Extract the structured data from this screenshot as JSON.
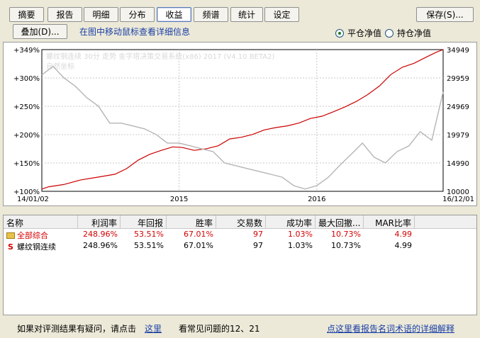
{
  "toolbar": {
    "tabs": [
      {
        "id": "summary",
        "label": "摘要",
        "active": false
      },
      {
        "id": "report",
        "label": "报告",
        "active": false
      },
      {
        "id": "detail",
        "label": "明细",
        "active": false
      },
      {
        "id": "distribution",
        "label": "分布",
        "active": false
      },
      {
        "id": "profit",
        "label": "收益",
        "active": true
      },
      {
        "id": "spectrum",
        "label": "频谱",
        "active": false
      },
      {
        "id": "statistics",
        "label": "统计",
        "active": false
      },
      {
        "id": "settings",
        "label": "设定",
        "active": false
      }
    ],
    "save_label": "保存(S)..."
  },
  "subbar": {
    "overlay_label": "叠加(D)...",
    "hint": "在图中移动鼠标查看详细信息",
    "radio_flat": "平仓净值",
    "radio_hold": "持仓净值",
    "radio_selected": "flat"
  },
  "chart_data": {
    "type": "line",
    "watermark_line1": "螺纹钢连续 30分 走势   金字塔决策交易系统(x86) 2017 (V4.10 BETA2)",
    "watermark_line2": "自然坐标",
    "x_labels": {
      "start": "14/01/02",
      "mid1": "2015",
      "mid2": "2016",
      "end": "16/12/01"
    },
    "x_range": [
      "2014-01-02",
      "2016-12-01"
    ],
    "left_axis": {
      "ticks": [
        "+349%",
        "+300%",
        "+250%",
        "+200%",
        "+150%",
        "+100%"
      ],
      "ylim": [
        100,
        349
      ]
    },
    "right_axis": {
      "ticks": [
        "34949",
        "29959",
        "24969",
        "19979",
        "14990",
        "10000"
      ],
      "ylim": [
        10000,
        34949
      ]
    },
    "series": [
      {
        "name": "",
        "axis": "left",
        "color": "#cc0000",
        "x": [
          "2014-01-02",
          "2014-01-20",
          "2014-03-01",
          "2014-04-15",
          "2014-06-01",
          "2014-07-15",
          "2014-08-15",
          "2014-09-15",
          "2014-10-15",
          "2014-11-15",
          "2014-12-15",
          "2015-01-10",
          "2015-02-10",
          "2015-03-15",
          "2015-04-15",
          "2015-05-15",
          "2015-06-15",
          "2015-07-15",
          "2015-08-15",
          "2015-09-15",
          "2015-10-15",
          "2015-11-15",
          "2015-12-15",
          "2016-01-15",
          "2016-02-15",
          "2016-03-15",
          "2016-04-15",
          "2016-05-15",
          "2016-06-15",
          "2016-07-15",
          "2016-08-15",
          "2016-09-15",
          "2016-10-15",
          "2016-11-15",
          "2016-12-01"
        ],
        "values": [
          104,
          108,
          112,
          120,
          125,
          130,
          140,
          155,
          165,
          172,
          178,
          177,
          172,
          175,
          180,
          192,
          195,
          200,
          208,
          212,
          215,
          220,
          228,
          232,
          240,
          248,
          258,
          270,
          285,
          305,
          318,
          325,
          335,
          345,
          349
        ]
      },
      {
        "name": "",
        "axis": "right",
        "color": "#b5b5b5",
        "x": [
          "2014-01-02",
          "2014-02-01",
          "2014-03-01",
          "2014-04-01",
          "2014-05-01",
          "2014-06-01",
          "2014-07-01",
          "2014-08-01",
          "2014-09-01",
          "2014-10-01",
          "2014-11-01",
          "2014-12-01",
          "2015-01-01",
          "2015-02-01",
          "2015-03-01",
          "2015-04-01",
          "2015-05-01",
          "2015-06-01",
          "2015-07-01",
          "2015-08-01",
          "2015-09-01",
          "2015-10-01",
          "2015-11-01",
          "2015-12-01",
          "2016-01-01",
          "2016-02-01",
          "2016-03-01",
          "2016-04-01",
          "2016-05-01",
          "2016-06-01",
          "2016-07-01",
          "2016-08-01",
          "2016-09-01",
          "2016-10-01",
          "2016-11-01",
          "2016-12-01"
        ],
        "values": [
          30500,
          32000,
          30000,
          28500,
          26500,
          25000,
          22000,
          22000,
          21500,
          21000,
          20000,
          18500,
          18500,
          18000,
          17500,
          17000,
          15000,
          14500,
          14000,
          13500,
          13000,
          12500,
          11000,
          10400,
          11000,
          12500,
          14500,
          16500,
          18500,
          16000,
          15000,
          17000,
          18000,
          20500,
          19000,
          27500
        ]
      }
    ]
  },
  "table": {
    "headers": [
      "名称",
      "利润率",
      "年回报",
      "胜率",
      "交易数",
      "成功率",
      "最大回撤...",
      "MAR比率"
    ],
    "rows": [
      {
        "icon": "folder-icon",
        "cells": [
          "全部综合",
          "248.96%",
          "53.51%",
          "67.01%",
          "97",
          "1.03%",
          "10.73%",
          "4.99"
        ]
      },
      {
        "icon": "s-icon",
        "icon_glyph": "S",
        "cells": [
          "螺纹钢连续",
          "248.96%",
          "53.51%",
          "67.01%",
          "97",
          "1.03%",
          "10.73%",
          "4.99"
        ]
      }
    ]
  },
  "status": {
    "question_text": "如果对评测结果有疑问，请点击",
    "here_link": "这里",
    "faq_text": "看常见问题的12、21",
    "glossary_link": "点这里看报告名词术语的详细解释"
  }
}
